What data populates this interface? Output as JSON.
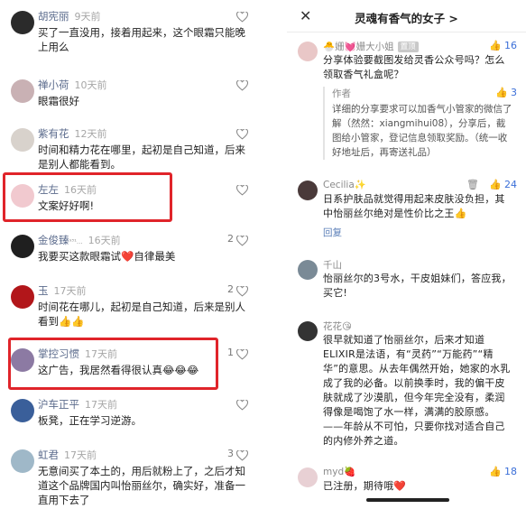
{
  "left_comments": [
    {
      "name": "胡宪丽",
      "time": "9天前",
      "text": "买了一直没用，接着用起来，这个眼霜只能晚上用么",
      "likes": ""
    },
    {
      "name": "禅小荷",
      "time": "10天前",
      "text": "眼霜很好",
      "likes": ""
    },
    {
      "name": "紫有花",
      "time": "12天前",
      "text": "时间和精力花在哪里，起初是自己知道，后来是别人都能看到。",
      "likes": ""
    },
    {
      "name": "左左",
      "time": "16天前",
      "text": "文案好好啊!",
      "likes": ""
    },
    {
      "name": "金俊臻",
      "name_suffix": "⁹³¹...",
      "time": "16天前",
      "text": "我要买这款眼霜试❤️自律最美",
      "likes": "2"
    },
    {
      "name": "玉",
      "time": "17天前",
      "text": "时间花在哪儿，起初是自己知道，后来是别人看到👍👍",
      "likes": "2"
    },
    {
      "name": "掌控习惯",
      "time": "17天前",
      "text": "这广告，我居然看得很认真😂😂😂",
      "likes": "1"
    },
    {
      "name": "沪车正平",
      "time": "17天前",
      "text": "板凳，正在学习逆游。",
      "likes": ""
    },
    {
      "name": "虹君",
      "time": "17天前",
      "text": "无意间买了本土的，用后就粉上了，之后才知道这个品牌国内叫怡丽丝尔，确实好，准备一直用下去了",
      "likes": "3"
    }
  ],
  "right_panel": {
    "title": "灵魂有香气的女子 >",
    "comments": [
      {
        "name": "🐣姗💓姗大小姐",
        "tag": "置顶",
        "likes": "16",
        "text": "分享体验要截图发给灵香公众号吗？怎么领取香气礼盒呢？",
        "reply_author": "作者",
        "reply_likes": "3",
        "reply_text": "详细的分享要求可以加香气小管家的微信了解（然然：xiangmihui08），分享后，截图给小管家，登记信息领取奖励。（统一收好地址后，再寄送礼品）"
      },
      {
        "name": "Cecilia✨",
        "likes": "24",
        "text": "日系护肤品就觉得用起来皮肤没负担，其中怡丽丝尔绝对是性价比之王👍",
        "reply_label": "回复"
      },
      {
        "name": "千山",
        "likes": "",
        "text": "怡丽丝尔的3号水，干皮姐妹们，答应我，买它!"
      },
      {
        "name": "花花😘",
        "likes": "",
        "text": "很早就知道了怡丽丝尔，后来才知道ELIXIR是法语，有“灵药”“万能药”“精华”的意思。从去年偶然开始，她家的水乳成了我的必备。以前换季时，我的偏干皮肤就成了沙漠肌，但今年完全没有，柔润得像是喝饱了水一样，满满的胶原感。——年龄从不可怕，只要你找对适合自己的内修外养之道。"
      },
      {
        "name": "myd🍓",
        "likes": "18",
        "text": "已注册，期待哦❤️"
      }
    ]
  },
  "colors": {
    "highlight_box": "#e0242a",
    "link": "#3b6fd8",
    "name": "#5b6b8c"
  }
}
